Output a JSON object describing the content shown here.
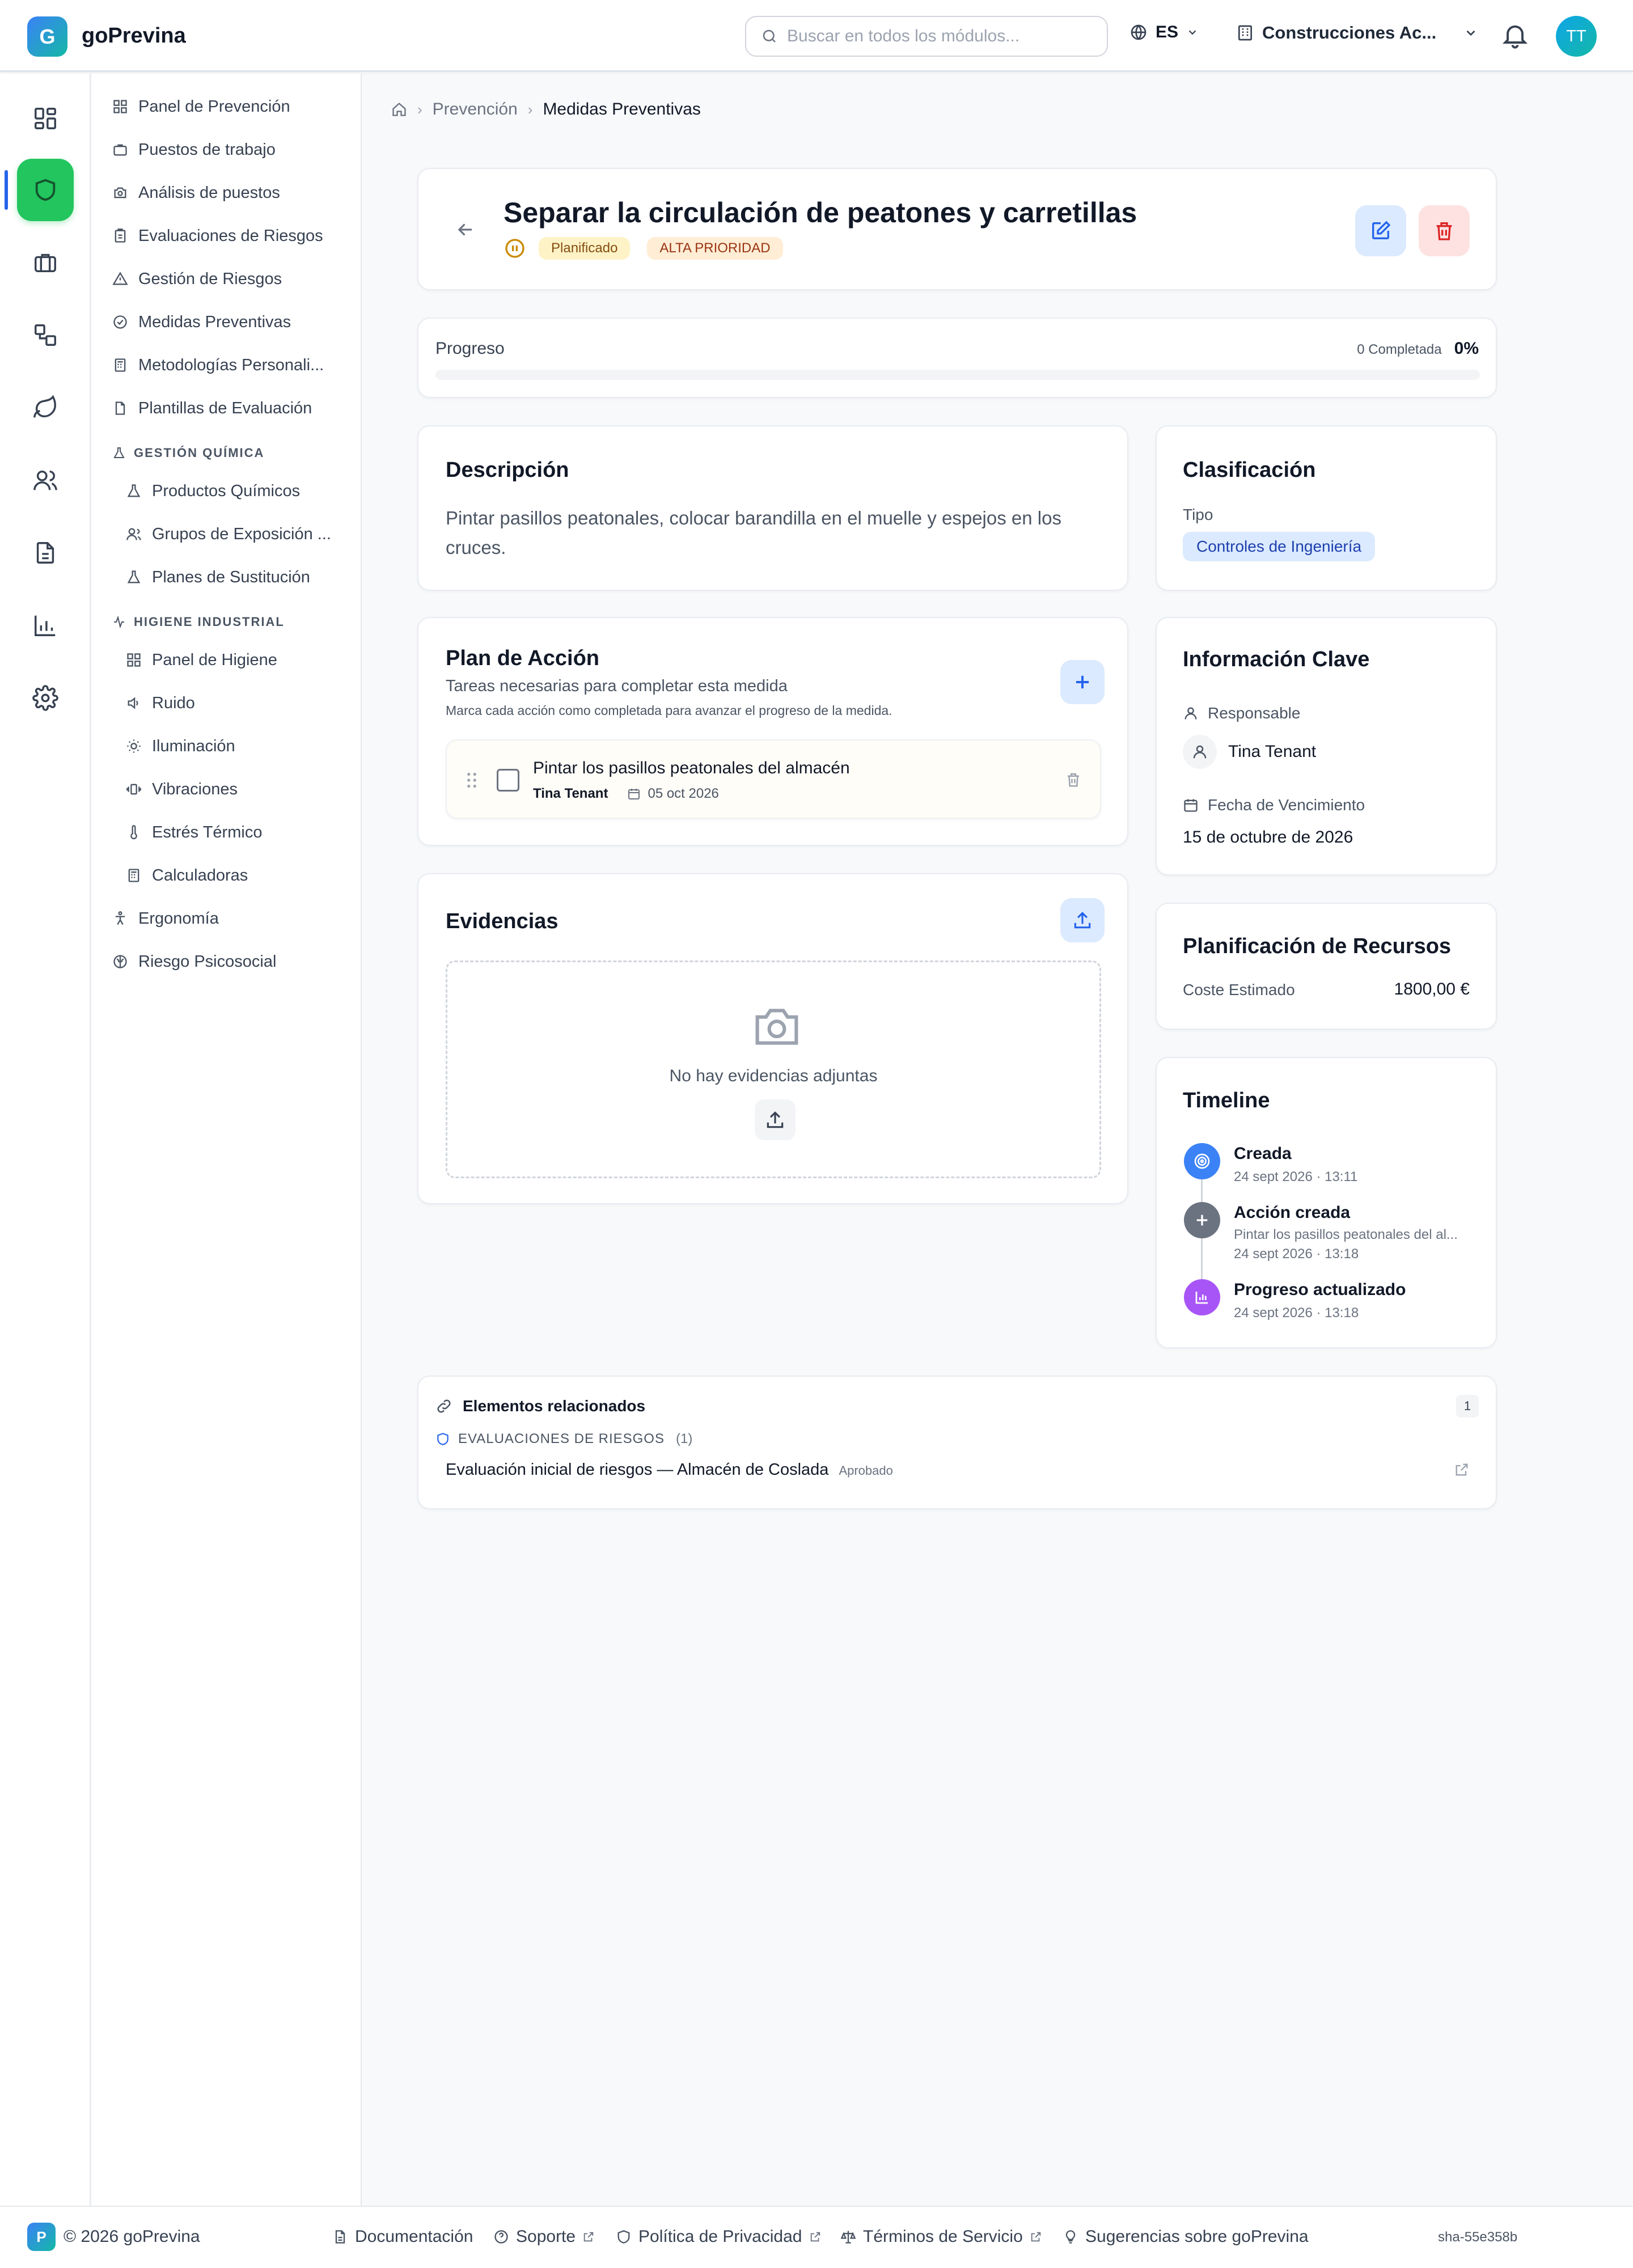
{
  "app": {
    "logo_letter": "G",
    "name": "goPrevina"
  },
  "topbar": {
    "search_placeholder": "Buscar en todos los módulos...",
    "language": "ES",
    "company": "Construcciones Ac...",
    "avatar_initials": "TT"
  },
  "rail_icons": [
    "dashboard-icon",
    "shield-icon",
    "briefcase-icon",
    "workflow-icon",
    "leaf-icon",
    "users-icon",
    "document-icon",
    "bar-chart-icon",
    "gear-icon"
  ],
  "sidebar": {
    "items": [
      {
        "label": "Panel de Prevención",
        "icon": "grid-icon"
      },
      {
        "label": "Puestos de trabajo",
        "icon": "briefcase-icon"
      },
      {
        "label": "Análisis de puestos",
        "icon": "camera-icon"
      },
      {
        "label": "Evaluaciones de Riesgos",
        "icon": "clipboard-icon"
      },
      {
        "label": "Gestión de Riesgos",
        "icon": "warning-icon"
      },
      {
        "label": "Medidas Preventivas",
        "icon": "check-circle-icon"
      },
      {
        "label": "Metodologías Personali...",
        "icon": "calculator-icon"
      },
      {
        "label": "Plantillas de Evaluación",
        "icon": "file-icon"
      }
    ],
    "section_chemical": "GESTIÓN QUÍMICA",
    "chemical_items": [
      {
        "label": "Productos Químicos",
        "icon": "flask-icon"
      },
      {
        "label": "Grupos de Exposición ...",
        "icon": "users-icon"
      },
      {
        "label": "Planes de Sustitución",
        "icon": "flask-icon"
      }
    ],
    "section_hygiene": "HIGIENE INDUSTRIAL",
    "hygiene_items": [
      {
        "label": "Panel de Higiene",
        "icon": "grid-icon"
      },
      {
        "label": "Ruido",
        "icon": "speaker-icon"
      },
      {
        "label": "Iluminación",
        "icon": "sun-icon"
      },
      {
        "label": "Vibraciones",
        "icon": "vibration-icon"
      },
      {
        "label": "Estrés Térmico",
        "icon": "thermometer-icon"
      },
      {
        "label": "Calculadoras",
        "icon": "calculator-icon"
      }
    ],
    "bottom_items": [
      {
        "label": "Ergonomía",
        "icon": "person-icon"
      },
      {
        "label": "Riesgo Psicosocial",
        "icon": "brain-icon"
      }
    ]
  },
  "breadcrumb": {
    "level1": "Prevención",
    "level2": "Medidas Preventivas"
  },
  "measure": {
    "title": "Separar la circulación de peatones y carretillas",
    "status": "Planificado",
    "priority": "ALTA PRIORIDAD",
    "status_color": "#fef3c7",
    "priority_color": "#ffedd5"
  },
  "progress": {
    "label": "Progreso",
    "completed_text": "0 Completada",
    "percent_text": "0%",
    "value": 0
  },
  "description": {
    "title": "Descripción",
    "text": "Pintar pasillos peatonales, colocar barandilla en el muelle y espejos en los cruces."
  },
  "action_plan": {
    "title": "Plan de Acción",
    "subtitle": "Tareas necesarias para completar esta medida",
    "hint": "Marca cada acción como completada para avanzar el progreso de la medida.",
    "tasks": [
      {
        "title": "Pintar los pasillos peatonales del almacén",
        "assignee": "Tina Tenant",
        "date": "05 oct 2026",
        "done": false
      }
    ]
  },
  "evidence": {
    "title": "Evidencias",
    "empty_text": "No hay evidencias adjuntas"
  },
  "classification": {
    "title": "Clasificación",
    "type_label": "Tipo",
    "type_value": "Controles de Ingeniería"
  },
  "key_info": {
    "title": "Información Clave",
    "responsible_label": "Responsable",
    "responsible_name": "Tina Tenant",
    "due_label": "Fecha de Vencimiento",
    "due_value": "15 de octubre de 2026"
  },
  "resources": {
    "title": "Planificación de Recursos",
    "cost_label": "Coste Estimado",
    "cost_value": "1800,00 €"
  },
  "timeline": {
    "title": "Timeline",
    "events": [
      {
        "title": "Creada",
        "detail": "",
        "time": "24 sept 2026 · 13:11",
        "color": "#3b82f6",
        "icon": "target-icon"
      },
      {
        "title": "Acción creada",
        "detail": "Pintar los pasillos peatonales del al...",
        "time": "24 sept 2026 · 13:18",
        "color": "#6b7280",
        "icon": "plus-icon"
      },
      {
        "title": "Progreso actualizado",
        "detail": "",
        "time": "24 sept 2026 · 13:18",
        "color": "#a855f7",
        "icon": "bar-chart-icon"
      }
    ]
  },
  "related": {
    "title": "Elementos relacionados",
    "count": "1",
    "group_label": "EVALUACIONES DE RIESGOS",
    "group_count": "(1)",
    "item_title": "Evaluación inicial de riesgos — Almacén de Coslada",
    "item_status": "Aprobado"
  },
  "footer": {
    "logo_letter": "P",
    "copyright": "© 2026 goPrevina",
    "links": [
      "Documentación",
      "Soporte",
      "Política de Privacidad",
      "Términos de Servicio",
      "Sugerencias sobre goPrevina"
    ],
    "version": "sha-55e358b"
  }
}
